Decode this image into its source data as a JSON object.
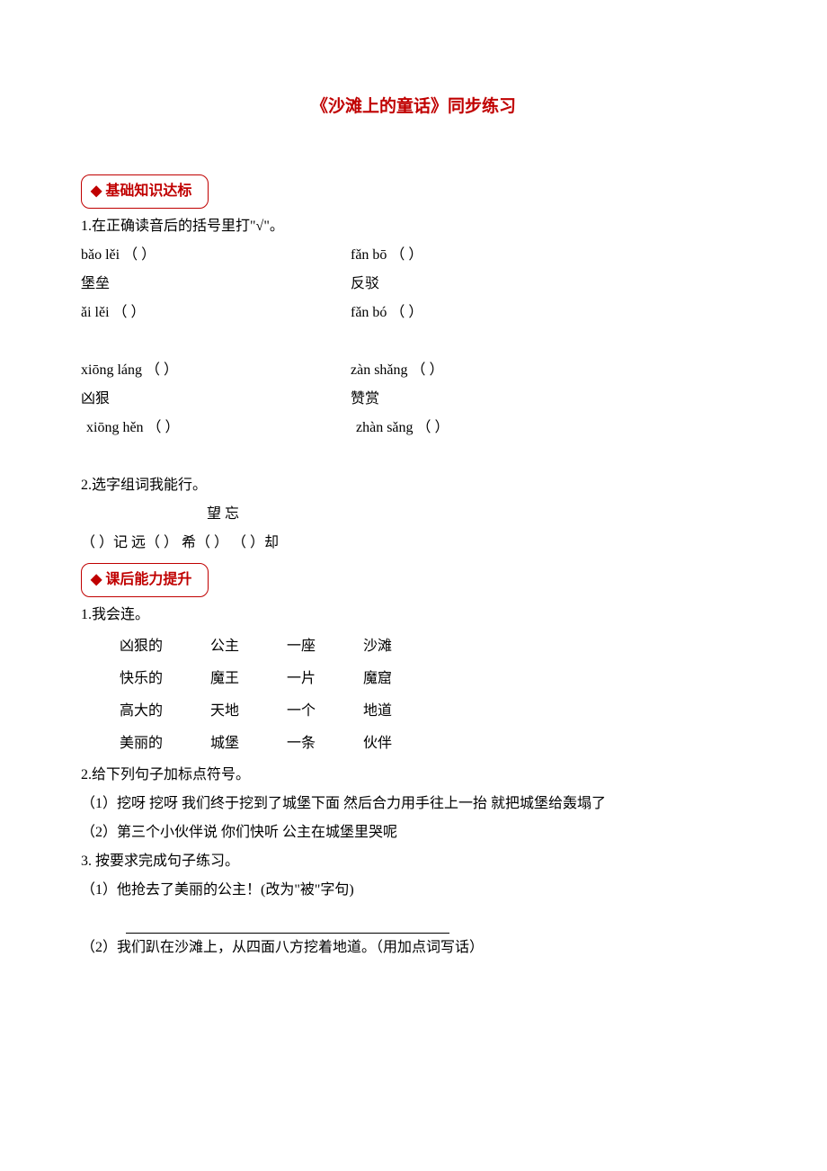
{
  "title": "《沙滩上的童话》同步练习",
  "section1": {
    "label": "基础知识达标",
    "diamond": "◆"
  },
  "q1": {
    "prompt": "1.在正确读音后的括号里打\"√\"。",
    "item1": {
      "py1": "bǎo lěi （   ）",
      "hz": "堡垒",
      "py2": "ǎi lěi （   ）"
    },
    "item2": {
      "py1": "fǎn bō （   ）",
      "hz": "反驳",
      "py2": "fǎn bó （   ）"
    },
    "item3": {
      "py1": "xiōng láng （   ）",
      "hz": "凶狠",
      "py2": "xiōng hěn （   ）"
    },
    "item4": {
      "py1": "zàn shǎng （   ）",
      "hz": "赞赏",
      "py2": "zhàn sǎng （   ）"
    }
  },
  "q2": {
    "prompt": "2.选字组词我能行。",
    "chars": "望     忘",
    "blanks": "（   ）记   远（   ）   希（   ）  （   ）却"
  },
  "section2": {
    "label": "课后能力提升",
    "diamond": "◆"
  },
  "p1": {
    "prompt": "1.我会连。",
    "rows": [
      [
        "凶狠的",
        "公主",
        "一座",
        "沙滩"
      ],
      [
        "快乐的",
        "魔王",
        "一片",
        "魔窟"
      ],
      [
        "高大的",
        "天地",
        "一个",
        "地道"
      ],
      [
        "美丽的",
        "城堡",
        "一条",
        "伙伴"
      ]
    ]
  },
  "p2": {
    "prompt": "2.给下列句子加标点符号。",
    "s1": "（1）挖呀   挖呀   我们终于挖到了城堡下面   然后合力用手往上一抬   就把城堡给轰塌了",
    "s2": "（2）第三个小伙伴说    你们快听   公主在城堡里哭呢"
  },
  "p3": {
    "prompt": "3. 按要求完成句子练习。",
    "s1": "（1）他抢去了美丽的公主！(改为\"被\"字句)",
    "s2": "（2）我们趴在沙滩上，从四面八方挖着地道。（用加点词写话）"
  }
}
